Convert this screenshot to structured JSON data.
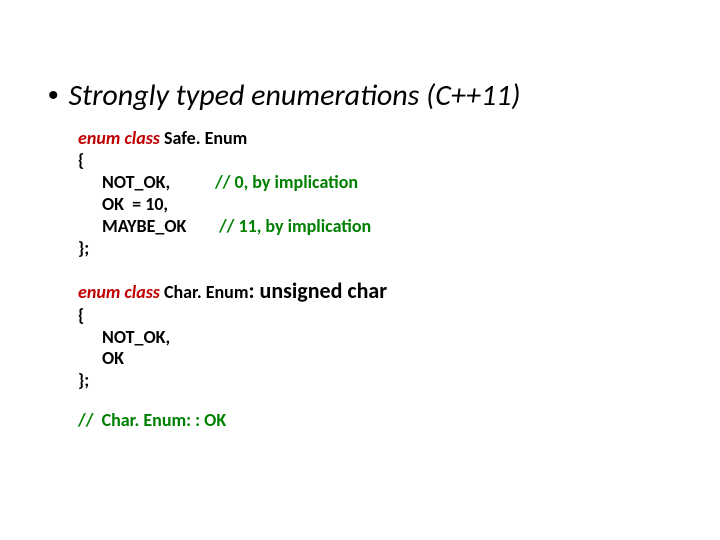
{
  "title": "Strongly typed enumerations (C++11)",
  "block1": {
    "decl_kw": "enum class",
    "decl_name": " Safe. Enum",
    "open": "{",
    "l1_a": "NOT_OK,           ",
    "l1_c": "// 0, by implication",
    "l2": "OK  = 10,",
    "l3_a": "MAYBE_OK        ",
    "l3_c": "// 11, by implication",
    "close": "};"
  },
  "block2": {
    "decl_kw": "enum class",
    "decl_mid": " Char. Enum",
    "decl_suffix": ": unsigned char",
    "open": "{",
    "l1": "NOT_OK,",
    "l2": "OK",
    "close": "};"
  },
  "footer": "//  Char. Enum: : OK"
}
